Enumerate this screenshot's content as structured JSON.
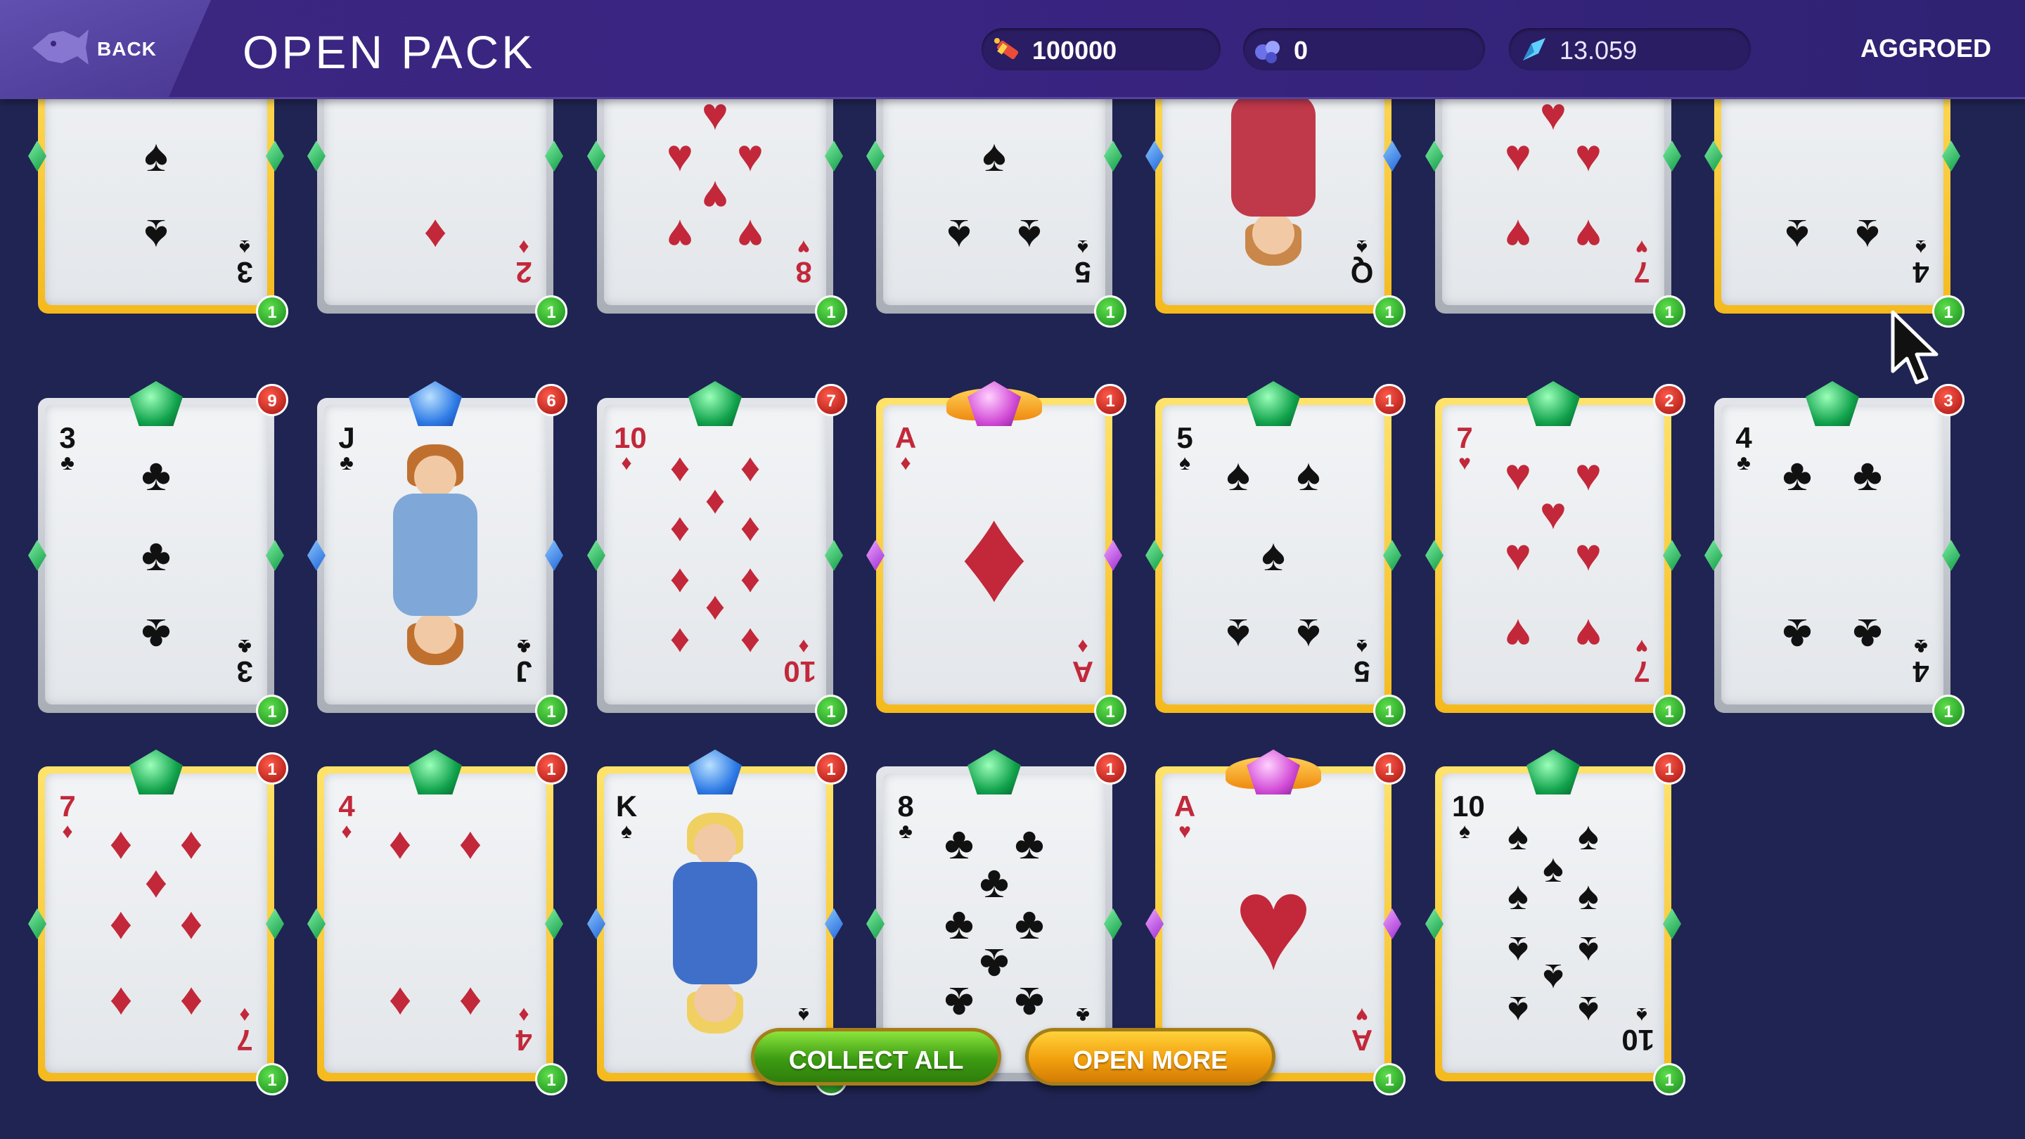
{
  "header": {
    "back_label": "BACK",
    "title": "OPEN PACK",
    "stats": [
      {
        "icon": "firecracker-icon",
        "value": "100000"
      },
      {
        "icon": "gem-cluster-icon",
        "value": "0"
      },
      {
        "icon": "crystal-icon",
        "value": "13.059"
      }
    ],
    "username": "AGGROED"
  },
  "cards": [
    {
      "rank": "3",
      "suit": "♠",
      "color": "black",
      "frame": "gold",
      "side_gem": "green",
      "count": "1",
      "top_gem": "",
      "level": ""
    },
    {
      "rank": "2",
      "suit": "♦",
      "color": "red",
      "frame": "silver",
      "side_gem": "green",
      "count": "1",
      "top_gem": "",
      "level": ""
    },
    {
      "rank": "8",
      "suit": "♥",
      "color": "red",
      "frame": "silver",
      "side_gem": "green",
      "count": "1",
      "top_gem": "",
      "level": ""
    },
    {
      "rank": "5",
      "suit": "♠",
      "color": "black",
      "frame": "silver",
      "side_gem": "green",
      "count": "1",
      "top_gem": "",
      "level": ""
    },
    {
      "rank": "Q",
      "suit": "♠",
      "color": "black",
      "frame": "gold",
      "side_gem": "blue",
      "count": "1",
      "top_gem": "",
      "level": ""
    },
    {
      "rank": "7",
      "suit": "♥",
      "color": "red",
      "frame": "silver",
      "side_gem": "green",
      "count": "1",
      "top_gem": "",
      "level": ""
    },
    {
      "rank": "4",
      "suit": "♠",
      "color": "black",
      "frame": "gold",
      "side_gem": "green",
      "count": "1",
      "top_gem": "",
      "level": ""
    },
    {
      "rank": "3",
      "suit": "♣",
      "color": "black",
      "frame": "silver",
      "side_gem": "green",
      "count": "1",
      "top_gem": "green",
      "level": "9"
    },
    {
      "rank": "J",
      "suit": "♣",
      "color": "black",
      "frame": "silver",
      "side_gem": "blue",
      "count": "1",
      "top_gem": "blue",
      "level": "6"
    },
    {
      "rank": "10",
      "suit": "♦",
      "color": "red",
      "frame": "silver",
      "side_gem": "green",
      "count": "1",
      "top_gem": "green",
      "level": "7"
    },
    {
      "rank": "A",
      "suit": "♦",
      "color": "red",
      "frame": "gold",
      "side_gem": "purple",
      "count": "1",
      "top_gem": "purple",
      "level": "1"
    },
    {
      "rank": "5",
      "suit": "♠",
      "color": "black",
      "frame": "gold",
      "side_gem": "green",
      "count": "1",
      "top_gem": "green",
      "level": "1"
    },
    {
      "rank": "7",
      "suit": "♥",
      "color": "red",
      "frame": "gold",
      "side_gem": "green",
      "count": "1",
      "top_gem": "green",
      "level": "2"
    },
    {
      "rank": "4",
      "suit": "♣",
      "color": "black",
      "frame": "silver",
      "side_gem": "green",
      "count": "1",
      "top_gem": "green",
      "level": "3"
    },
    {
      "rank": "7",
      "suit": "♦",
      "color": "red",
      "frame": "gold",
      "side_gem": "green",
      "count": "1",
      "top_gem": "green",
      "level": "1"
    },
    {
      "rank": "4",
      "suit": "♦",
      "color": "red",
      "frame": "gold",
      "side_gem": "green",
      "count": "1",
      "top_gem": "green",
      "level": "1"
    },
    {
      "rank": "K",
      "suit": "♠",
      "color": "black",
      "frame": "gold",
      "side_gem": "blue",
      "count": "1",
      "top_gem": "blue",
      "level": "1"
    },
    {
      "rank": "8",
      "suit": "♣",
      "color": "black",
      "frame": "silver",
      "side_gem": "green",
      "count": "",
      "top_gem": "green",
      "level": "1"
    },
    {
      "rank": "A",
      "suit": "♥",
      "color": "red",
      "frame": "gold",
      "side_gem": "purple",
      "count": "1",
      "top_gem": "purple",
      "level": "1"
    },
    {
      "rank": "10",
      "suit": "♠",
      "color": "black",
      "frame": "gold",
      "side_gem": "green",
      "count": "1",
      "top_gem": "green",
      "level": "1"
    }
  ],
  "actions": {
    "collect_all_label": "COLLECT ALL",
    "open_more_label": "OPEN MORE"
  },
  "colors": {
    "background": "#1f2452",
    "header": "#3a2582",
    "suit_red": "#c2283a",
    "count_badge": "#2fa12a",
    "level_badge": "#c0201a"
  }
}
